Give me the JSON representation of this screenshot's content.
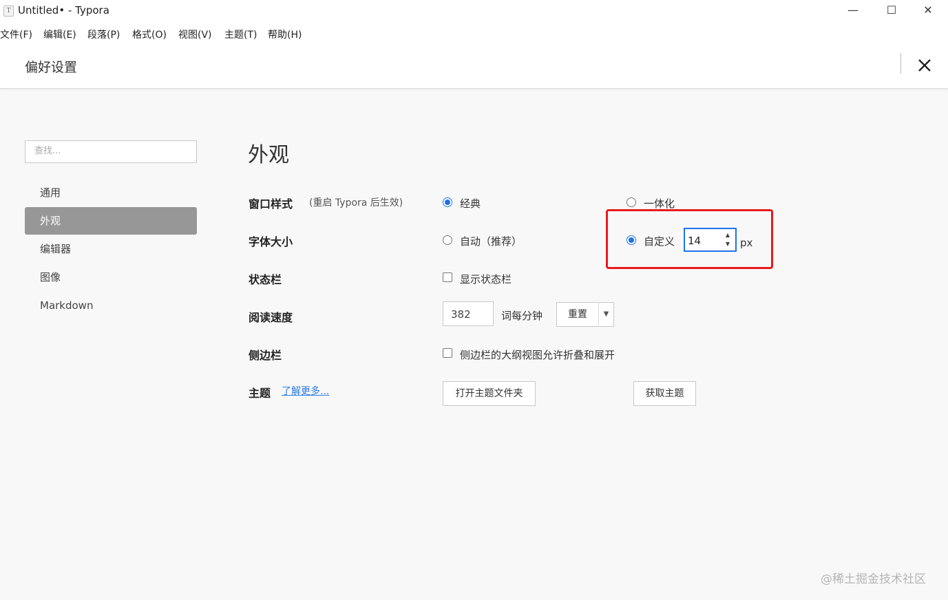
{
  "window": {
    "title": "Untitled• - Typora",
    "app_icon_letter": "T",
    "controls": {
      "minimize": "—",
      "maximize": "☐",
      "close": "✕"
    }
  },
  "menubar": [
    "文件(F)",
    "编辑(E)",
    "段落(P)",
    "格式(O)",
    "视图(V)",
    "主题(T)",
    "帮助(H)"
  ],
  "preferences": {
    "title": "偏好设置",
    "search_placeholder": "查找...",
    "nav": [
      "通用",
      "外观",
      "编辑器",
      "图像",
      "Markdown"
    ],
    "active_nav": "外观",
    "section_title": "外观",
    "rows": {
      "window_style": {
        "label": "窗口样式",
        "note": "(重启 Typora 后生效)",
        "options": [
          "经典",
          "一体化"
        ],
        "selected": "经典"
      },
      "font_size": {
        "label": "字体大小",
        "options": [
          "自动（推荐）",
          "自定义"
        ],
        "selected": "自定义",
        "value": "14",
        "unit": "px"
      },
      "status_bar": {
        "label": "状态栏",
        "checkbox_label": "显示状态栏",
        "checked": false
      },
      "reading_speed": {
        "label": "阅读速度",
        "value": "382",
        "unit": "词每分钟",
        "reset_button": "重置",
        "dropdown_glyph": "▼"
      },
      "sidebar": {
        "label": "侧边栏",
        "checkbox_label": "侧边栏的大纲视图允许折叠和展开",
        "checked": false
      },
      "theme": {
        "label": "主题",
        "learn_more": "了解更多...",
        "open_folder_button": "打开主题文件夹",
        "get_themes_button": "获取主题"
      }
    }
  },
  "watermark": "@稀土掘金技术社区",
  "colors": {
    "accent": "#1a73e8",
    "active_nav_bg": "#979797",
    "highlight": "#e8191b",
    "link": "#2a7ae2"
  }
}
